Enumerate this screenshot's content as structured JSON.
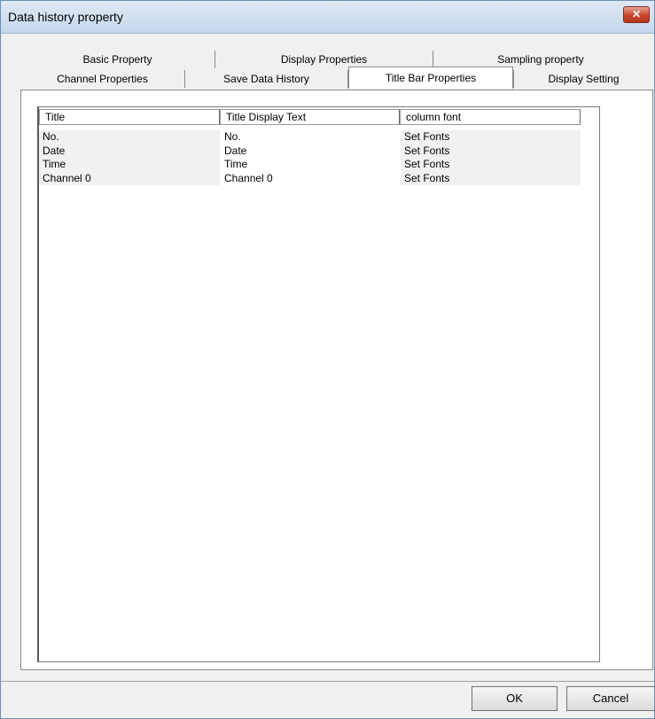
{
  "window": {
    "title": "Data history property"
  },
  "tabs": {
    "row1": [
      "Basic Property",
      "Display Properties",
      "Sampling property"
    ],
    "row2": [
      "Channel Properties",
      "Save Data History",
      "Title Bar Properties",
      "Display Setting"
    ],
    "active": "Title Bar Properties"
  },
  "table": {
    "columns": [
      "Title",
      "Title Display Text",
      "column font"
    ],
    "rows": [
      [
        "No.",
        "No.",
        "Set Fonts"
      ],
      [
        "Date",
        "Date",
        "Set Fonts"
      ],
      [
        "Time",
        "Time",
        "Set Fonts"
      ],
      [
        "Channel 0",
        "Channel 0",
        "Set Fonts"
      ]
    ]
  },
  "buttons": {
    "ok": "OK",
    "cancel": "Cancel",
    "close": "✕"
  },
  "icons": {
    "close": "close-icon"
  },
  "colors": {
    "title_close": "#c7452d",
    "panel_bg": "#ffffff",
    "dialog_bg": "#f0f0f0"
  }
}
